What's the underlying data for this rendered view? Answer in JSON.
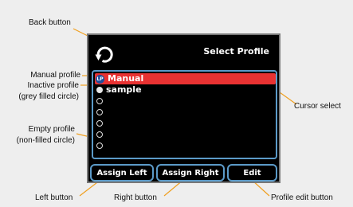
{
  "screen": {
    "title": "Select Profile",
    "back_icon": "rotate-back-arrow-icon",
    "profiles": [
      {
        "label": "Manual",
        "icon": "manual-profile-icon",
        "icon_text": "LP",
        "selected": true
      },
      {
        "label": "sample",
        "icon": "grey-filled-circle",
        "selected": false
      },
      {
        "label": "",
        "icon": "empty-circle"
      },
      {
        "label": "",
        "icon": "empty-circle"
      },
      {
        "label": "",
        "icon": "empty-circle"
      },
      {
        "label": "",
        "icon": "empty-circle"
      },
      {
        "label": "",
        "icon": "empty-circle"
      }
    ],
    "buttons": {
      "assign_left": "Assign Left",
      "assign_right": "Assign Right",
      "edit": "Edit"
    }
  },
  "callouts": {
    "back_button": "Back button",
    "manual_profile": "Manual profile",
    "inactive_profile_1": "Inactive profile",
    "inactive_profile_2": "(grey filled circle)",
    "empty_profile_1": "Empty profile",
    "empty_profile_2": "(non-filled circle)",
    "cursor_select": "Cursor select",
    "left_button": "Left button",
    "right_button": "Right button",
    "profile_edit_button": "Profile edit button"
  },
  "colors": {
    "background": "#eeeeee",
    "screen": "#000000",
    "accent_blue": "#5b9ac8",
    "selection_red": "#e83232",
    "leader_orange": "#f0a020"
  }
}
